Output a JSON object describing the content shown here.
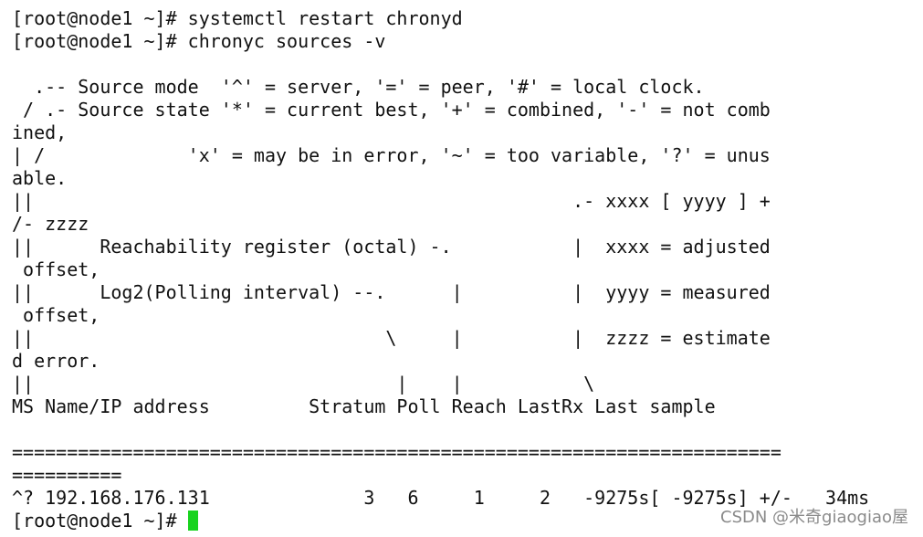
{
  "terminal": {
    "lines": [
      "[root@node1 ~]# systemctl restart chronyd",
      "[root@node1 ~]# chronyc sources -v",
      "",
      "  .-- Source mode  '^' = server, '=' = peer, '#' = local clock.",
      " / .- Source state '*' = current best, '+' = combined, '-' = not comb",
      "ined,",
      "| /             'x' = may be in error, '~' = too variable, '?' = unus",
      "able.",
      "||                                                 .- xxxx [ yyyy ] +",
      "/- zzzz",
      "||      Reachability register (octal) -.           |  xxxx = adjusted",
      " offset,",
      "||      Log2(Polling interval) --.      |          |  yyyy = measured",
      " offset,",
      "||                                \\     |          |  zzzz = estimate",
      "d error.",
      "||                                 |    |           \\",
      "MS Name/IP address         Stratum Poll Reach LastRx Last sample",
      "",
      "======================================================================",
      "==========",
      "^? 192.168.176.131              3   6     1     2   -9275s[ -9275s] +/-   34ms"
    ],
    "prompt": "[root@node1 ~]# ",
    "cursor_color": "#18d31e"
  },
  "watermark": {
    "text": "CSDN @米奇giaogiao屋"
  }
}
